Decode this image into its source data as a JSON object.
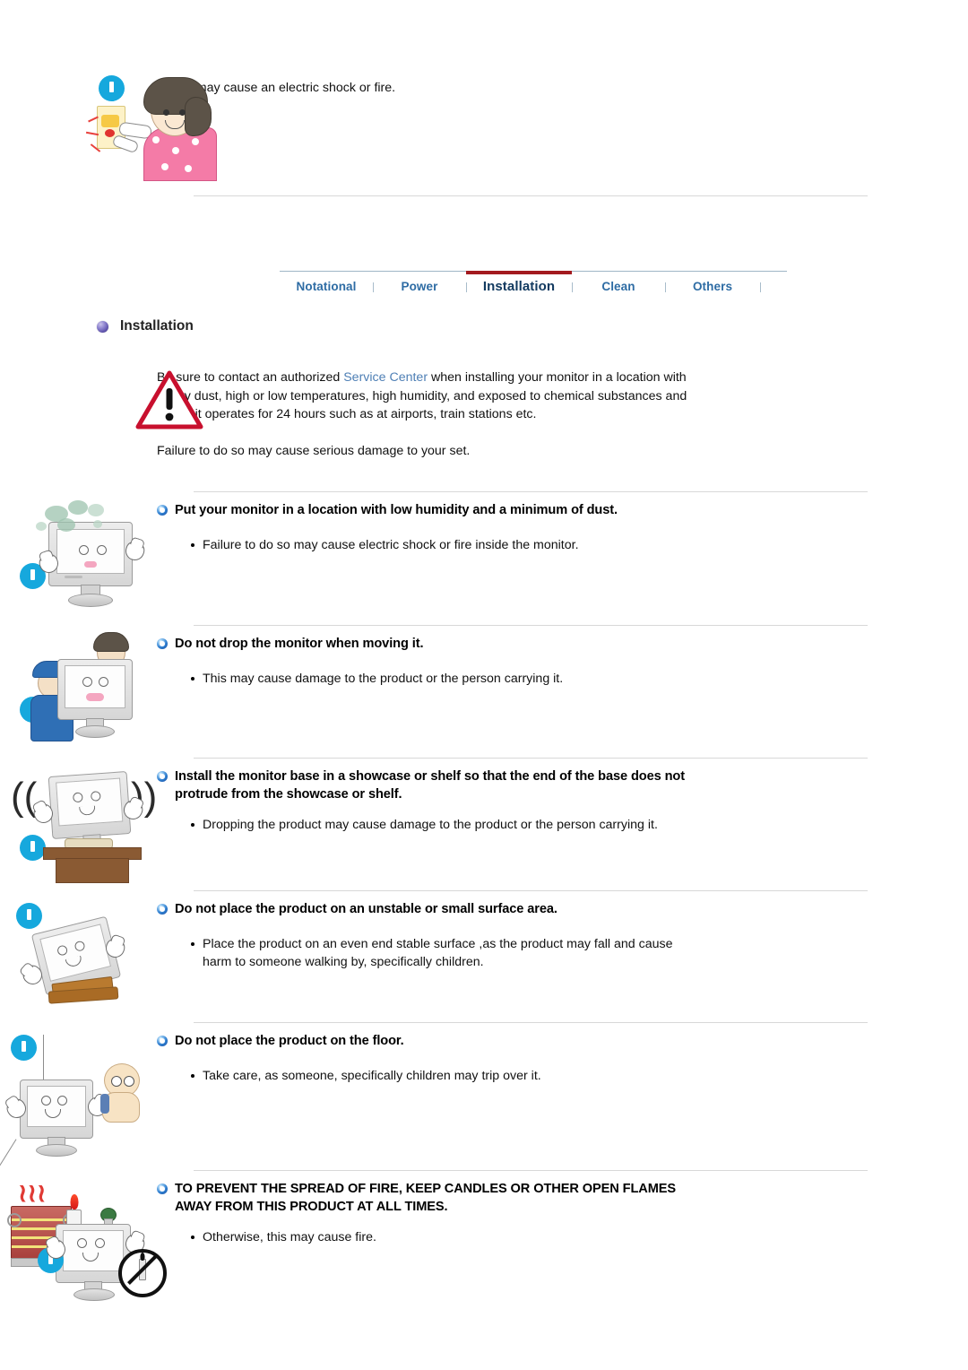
{
  "document": {
    "title": "Installation",
    "top_note": {
      "bullet": "This may cause an electric shock or fire.",
      "icon": "exclamation-badge-icon",
      "illustration": "woman-plugging-outlet-illustration"
    },
    "tabs": [
      {
        "label": "Notational",
        "active": false
      },
      {
        "label": "Power",
        "active": false
      },
      {
        "label": "Installation",
        "active": true
      },
      {
        "label": "Clean",
        "active": false
      },
      {
        "label": "Others",
        "active": false
      }
    ],
    "section_heading": "Installation",
    "warning": {
      "icon": "warning-triangle-icon",
      "text_before_link": "Be sure to contact an authorized ",
      "link_text": "Service Center",
      "text_after_link": " when installing your monitor in a location with heavy dust, high or low temperatures, high humidity, and exposed to chemical substances and where it operates for 24 hours such as at airports, train stations etc.",
      "footer": "Failure to do so may cause serious damage to your set."
    },
    "items": [
      {
        "heading": "Put your monitor in a location with low humidity and a minimum of dust.",
        "bullet": "Failure to do so may cause electric shock or fire inside the monitor.",
        "illustration": "dusty-monitor-illustration",
        "badge": "exclamation-badge-icon"
      },
      {
        "heading": "Do not drop the monitor when moving it.",
        "bullet": "This may cause damage to the product or the person carrying it.",
        "illustration": "two-people-carrying-monitor-illustration",
        "badge": "exclamation-badge-icon"
      },
      {
        "heading": "Install the monitor base in a showcase or shelf so that the end of the base does not protrude from the showcase or shelf.",
        "bullet": "Dropping the product may cause damage to the product or the person carrying it.",
        "illustration": "monitor-wobbling-on-shelf-illustration",
        "badge": "exclamation-badge-icon"
      },
      {
        "heading": "Do not place the product on an unstable or small surface area.",
        "bullet": "Place the product on an even end stable surface ,as the product may fall and cause harm to someone walking by, specifically children.",
        "illustration": "monitor-tipping-off-small-stand-illustration",
        "badge": "exclamation-badge-icon"
      },
      {
        "heading": "Do not place the product on the floor.",
        "bullet": "Take care, as someone, specifically children may trip over it.",
        "illustration": "monitor-on-floor-with-child-illustration",
        "badge": "exclamation-badge-icon"
      },
      {
        "heading": "TO PREVENT THE SPREAD OF FIRE, KEEP CANDLES OR OTHER OPEN FLAMES AWAY FROM THIS PRODUCT AT ALL TIMES.",
        "bullet": "Otherwise, this may cause fire.",
        "illustration": "heater-candle-monitor-no-flame-illustration",
        "badge": "exclamation-badge-icon"
      }
    ],
    "colors": {
      "tab_link": "#2e6ca4",
      "tab_active_text": "#123a60",
      "tab_active_underline": "#a31a1f",
      "link": "#4e7fb5",
      "badge_blue": "#16a8dd",
      "warning_red": "#c8102e",
      "divider": "#d8d8d8"
    }
  }
}
